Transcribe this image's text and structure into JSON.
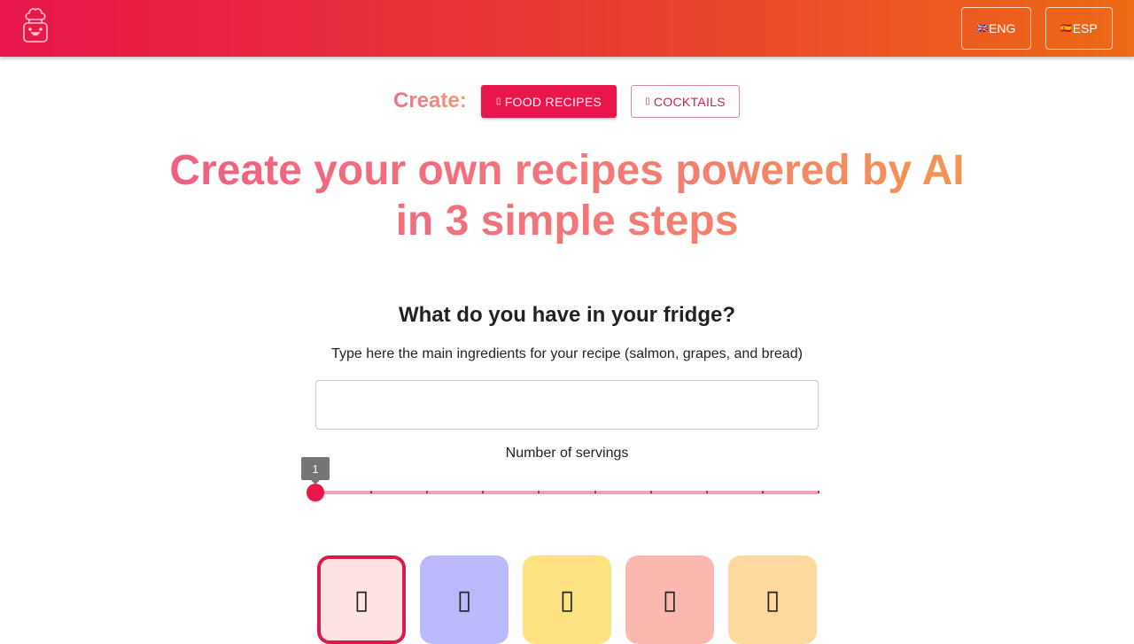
{
  "navbar": {
    "logo_icon": "chef-robot-logo-icon",
    "languages": [
      {
        "label": "ENG",
        "flag": "🇬🇧"
      },
      {
        "label": "ESP",
        "flag": "🇪🇸"
      }
    ]
  },
  "create": {
    "label": "Create:",
    "modes": [
      {
        "label": "FOOD RECIPES",
        "icon": "utensils-icon",
        "active": true
      },
      {
        "label": "COCKTAILS",
        "icon": "cocktail-icon",
        "active": false
      }
    ]
  },
  "hero": {
    "title": "Create your own recipes powered by AI in 3 simple steps"
  },
  "fridge": {
    "title": "What do you have in your fridge?",
    "description": "Type here the main ingredients for your recipe (salmon, grapes, and bread)",
    "input_value": "",
    "input_placeholder": ""
  },
  "servings": {
    "label": "Number of servings",
    "value": "1",
    "min": 1,
    "max": 10
  },
  "categories": [
    {
      "icon": "category-icon-1",
      "color": "#ffe3e3",
      "selected": true
    },
    {
      "icon": "category-icon-2",
      "color": "#babafc",
      "selected": false
    },
    {
      "icon": "category-icon-3",
      "color": "#fee180",
      "selected": false
    },
    {
      "icon": "category-icon-4",
      "color": "#fbb8ae",
      "selected": false
    },
    {
      "icon": "category-icon-5",
      "color": "#fed89d",
      "selected": false
    }
  ]
}
